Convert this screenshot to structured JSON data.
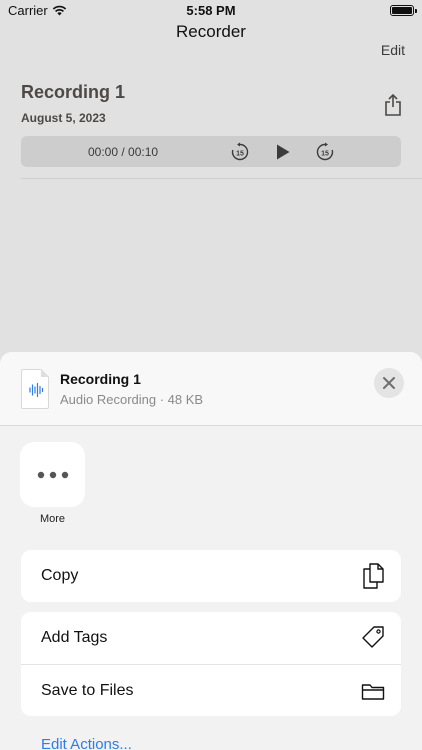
{
  "status_bar": {
    "carrier": "Carrier",
    "time": "5:58 PM"
  },
  "nav": {
    "title": "Recorder",
    "edit_label": "Edit"
  },
  "recording": {
    "title": "Recording 1",
    "date": "August 5, 2023",
    "time_display": "00:00 / 00:10",
    "skip_seconds": "15"
  },
  "share_sheet": {
    "file_name": "Recording 1",
    "file_meta": "Audio Recording · 48 KB",
    "more_label": "More",
    "actions_group1": [
      {
        "label": "Copy",
        "icon": "copy-icon"
      }
    ],
    "actions_group2": [
      {
        "label": "Add Tags",
        "icon": "tag-icon"
      },
      {
        "label": "Save to Files",
        "icon": "folder-icon"
      }
    ],
    "edit_actions_label": "Edit Actions..."
  }
}
